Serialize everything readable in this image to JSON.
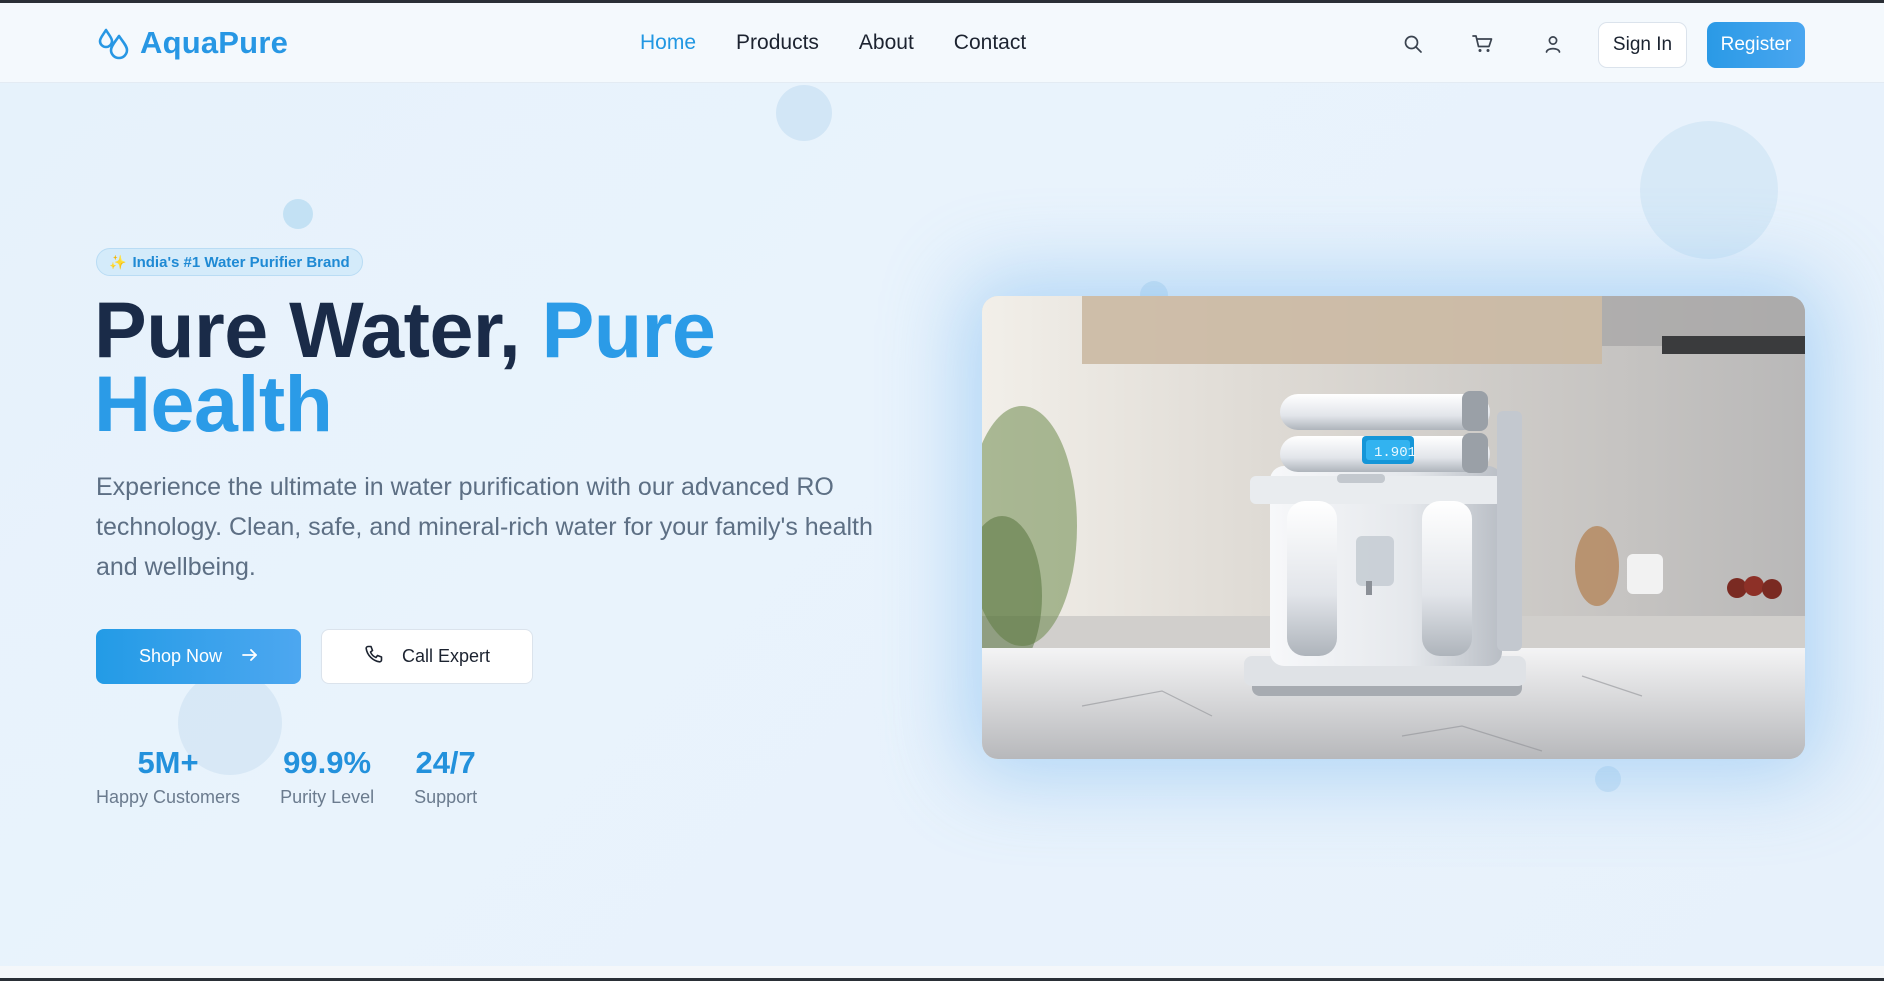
{
  "brand": {
    "name": "AquaPure",
    "accent": "#2797e4"
  },
  "nav": {
    "links": [
      {
        "label": "Home",
        "active": true
      },
      {
        "label": "Products",
        "active": false
      },
      {
        "label": "About",
        "active": false
      },
      {
        "label": "Contact",
        "active": false
      }
    ],
    "icons": [
      "search-icon",
      "cart-icon",
      "user-icon"
    ],
    "sign_in": "Sign In",
    "register": "Register"
  },
  "hero": {
    "badge": {
      "icon": "sparkle-icon",
      "text": "India's #1 Water Purifier Brand"
    },
    "headline_part1": "Pure Water, ",
    "headline_part2": "Pure",
    "headline_part3": "Health",
    "description": "Experience the ultimate in water purification with our advanced RO technology. Clean, safe, and mineral-rich water for your family's health and wellbeing.",
    "primary_button": {
      "label": "Shop Now",
      "icon": "arrow-right-icon"
    },
    "secondary_button": {
      "label": "Call Expert",
      "icon": "phone-icon"
    },
    "stats": [
      {
        "value": "5M+",
        "label": "Happy Customers"
      },
      {
        "value": "99.9%",
        "label": "Purity Level"
      },
      {
        "value": "24/7",
        "label": "Support"
      }
    ],
    "image": {
      "subject": "water-purifier-kitchen-photo",
      "display_reading": "1.901"
    }
  },
  "colors": {
    "primary": "#2b9be7",
    "heading": "#1a2b48",
    "body_text": "#5d6f84",
    "background": "#e6f2fb"
  }
}
